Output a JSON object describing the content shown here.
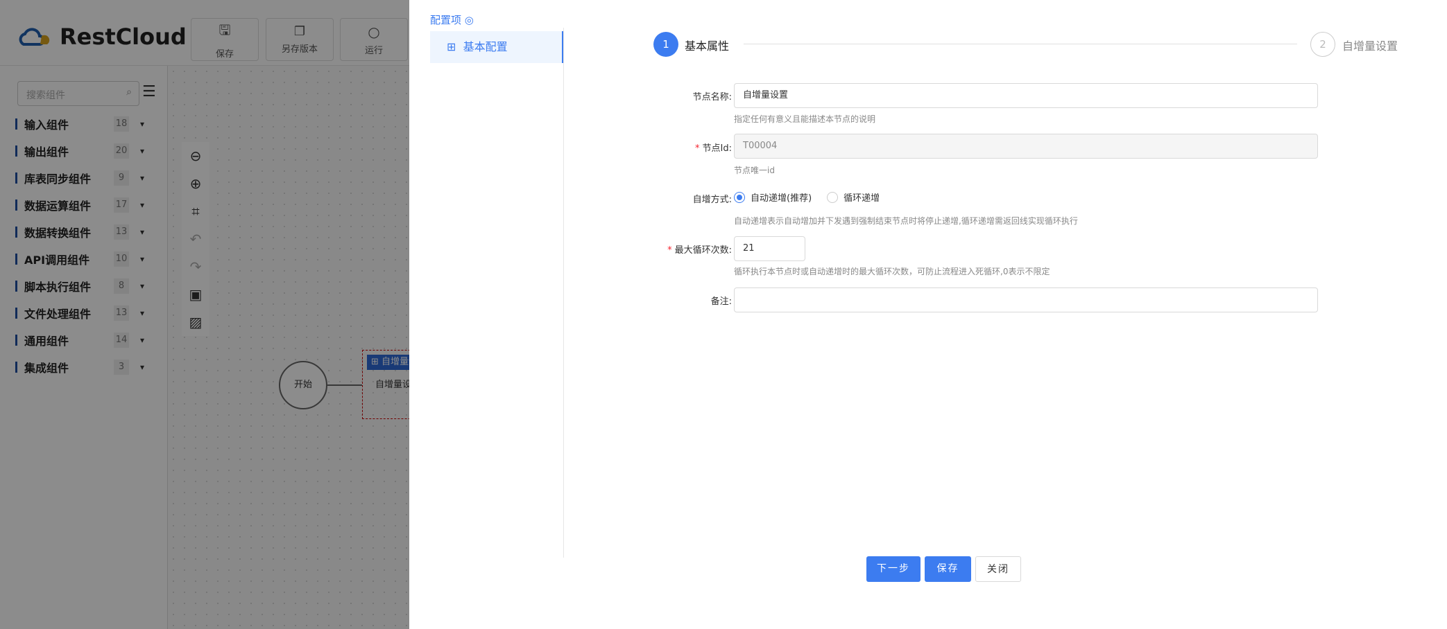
{
  "app": {
    "logo": "RestCloud"
  },
  "toolbar": [
    {
      "label": "保存",
      "icon": "save-icon"
    },
    {
      "label": "另存版本",
      "icon": "save-version-icon"
    },
    {
      "label": "运行",
      "icon": "run-icon"
    }
  ],
  "sidebar": {
    "search_placeholder": "搜索组件",
    "categories": [
      {
        "label": "输入组件",
        "count": "18"
      },
      {
        "label": "输出组件",
        "count": "20"
      },
      {
        "label": "库表同步组件",
        "count": "9"
      },
      {
        "label": "数据运算组件",
        "count": "17"
      },
      {
        "label": "数据转换组件",
        "count": "13"
      },
      {
        "label": "API调用组件",
        "count": "10"
      },
      {
        "label": "脚本执行组件",
        "count": "8"
      },
      {
        "label": "文件处理组件",
        "count": "13"
      },
      {
        "label": "通用组件",
        "count": "14"
      },
      {
        "label": "集成组件",
        "count": "3"
      }
    ]
  },
  "canvas": {
    "start_node": "开始",
    "node_header": "自增量设置",
    "node_body": "自增量设置"
  },
  "drawer": {
    "config_title": "配置项",
    "menu_item": "基本配置",
    "steps": [
      {
        "num": "1",
        "label": "基本属性"
      },
      {
        "num": "2",
        "label": "自增量设置"
      }
    ],
    "form": {
      "name_label": "节点名称:",
      "name_value": "自增量设置",
      "name_hint": "指定任何有意义且能描述本节点的说明",
      "id_label": "节点Id:",
      "id_value": "T00004",
      "id_hint": "节点唯一id",
      "mode_label": "自增方式:",
      "mode_options": [
        "自动递增(推荐)",
        "循环递增"
      ],
      "mode_selected": "自动递增(推荐)",
      "mode_hint": "自动递增表示自动增加并下发遇到强制结束节点时将停止递增,循环递增需返回线实现循环执行",
      "max_label": "最大循环次数:",
      "max_value": "21",
      "max_hint": "循环执行本节点时或自动递增时的最大循环次数，可防止流程进入死循环,0表示不限定",
      "remark_label": "备注:",
      "remark_value": ""
    },
    "buttons": {
      "next": "下一步",
      "save": "保存",
      "close": "关闭"
    },
    "accent": "#3c7cf0"
  }
}
